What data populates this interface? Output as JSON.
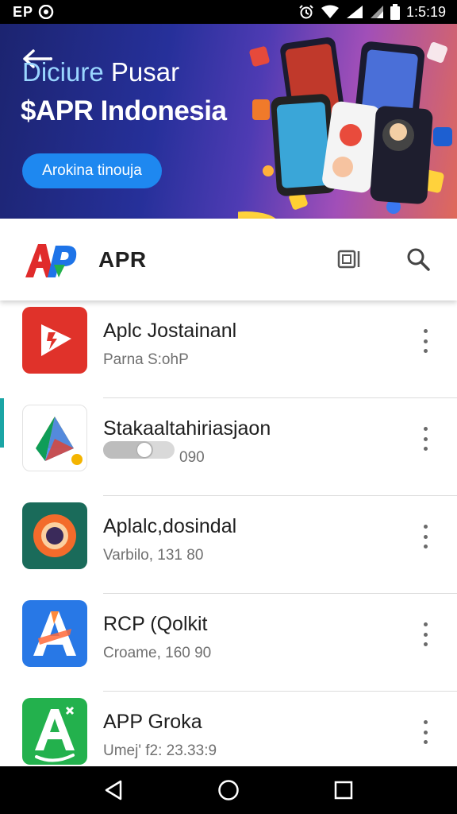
{
  "status_bar": {
    "left_text": "EP",
    "time": "1:5:19"
  },
  "banner": {
    "title_accent": "Diciure",
    "title_rest": "Pusar",
    "subtitle": "$APR Indonesia",
    "cta_label": "Arokina tinouja"
  },
  "toolbar": {
    "app_title": "APR",
    "cast_icon": "cast-icon",
    "search_icon": "search-icon"
  },
  "apps": [
    {
      "name": "Aplc Jostainanl",
      "meta": "Parna S:ohP",
      "icon": "video-app-icon",
      "color": "#e0322a"
    },
    {
      "name": "Stakaaltahiriasjaon",
      "meta": "090",
      "icon": "drive-app-icon",
      "color": "#ffffff",
      "progress": 0.7
    },
    {
      "name": "Aplalc,dosindal",
      "meta": "Varbilo, 131 80",
      "icon": "camera-app-icon",
      "color": "#1a6b5a"
    },
    {
      "name": "RCP (Qolkit",
      "meta": "Croame, 160 90",
      "icon": "a-letter-app-icon",
      "color": "#2878e6"
    },
    {
      "name": "APP Groka",
      "meta": "Umej' f2: 23.33:9",
      "icon": "green-a-app-icon",
      "color": "#23b14d"
    }
  ],
  "colors": {
    "accent": "#1e88f0",
    "active_marker": "#1aa5a5"
  }
}
